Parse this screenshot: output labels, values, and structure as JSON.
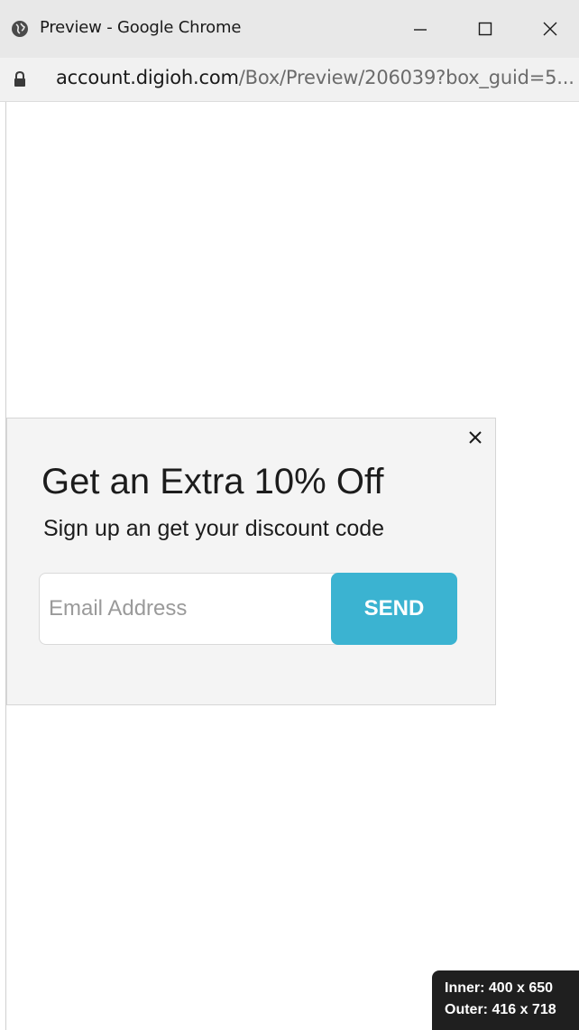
{
  "window": {
    "title": "Preview - Google Chrome"
  },
  "address_bar": {
    "url_host": "account.digioh.com",
    "url_path": "/Box/Preview/206039?box_guid=5..."
  },
  "popup": {
    "heading": "Get an Extra 10% Off",
    "subheading": "Sign up an get your discount code",
    "email_placeholder": "Email Address",
    "email_value": "",
    "send_label": "SEND",
    "accent_color": "#3bb3d1"
  },
  "size_badge": {
    "inner": "Inner: 400 x 650",
    "outer": "Outer: 416 x 718"
  },
  "icons": {
    "title": "globe-icon",
    "address": "lock-icon",
    "window_controls": [
      "minimize-icon",
      "maximize-icon",
      "close-icon"
    ],
    "popup": "close-icon"
  }
}
